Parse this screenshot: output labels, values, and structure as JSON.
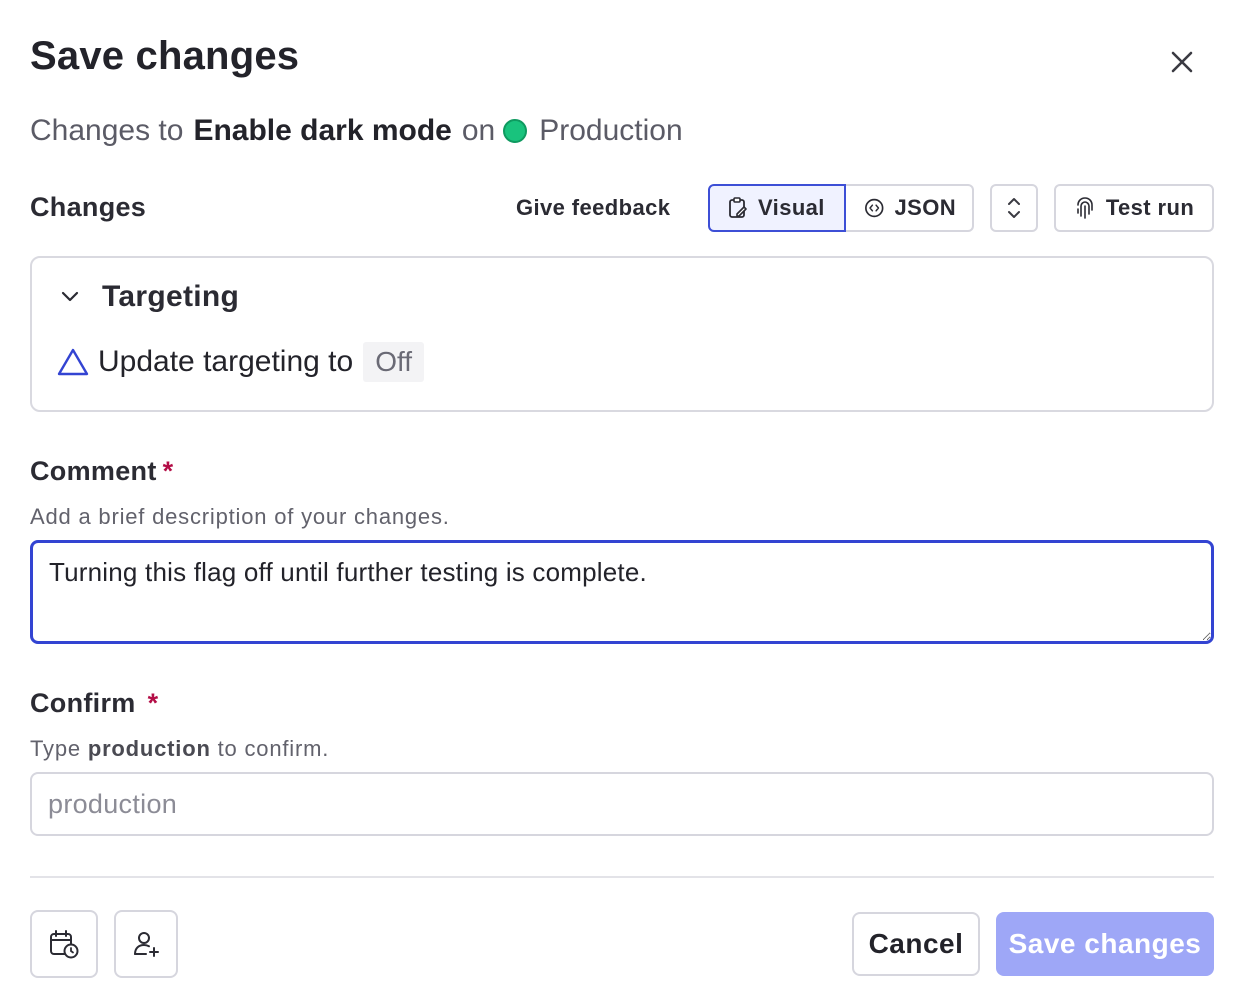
{
  "dialog": {
    "title": "Save changes",
    "close_icon": "close-icon"
  },
  "subtitle": {
    "prefix": "Changes to",
    "flag_name": "Enable dark mode",
    "connector": "on",
    "environment": "Production",
    "environment_color": "#19c37d"
  },
  "changes": {
    "label": "Changes",
    "feedback_label": "Give feedback",
    "view_tabs": [
      {
        "label": "Visual",
        "icon": "clipboard-edit-icon",
        "selected": true
      },
      {
        "label": "JSON",
        "icon": "code-circle-icon",
        "selected": false
      }
    ],
    "expand_icon": "chevron-up-down-icon",
    "test_run_label": "Test run",
    "test_run_icon": "fingerprint-icon"
  },
  "targeting": {
    "section_label": "Targeting",
    "toggle_icon": "chevron-down-icon",
    "update_text": "Update targeting to",
    "update_value": "Off",
    "warning_icon": "warning-triangle-icon"
  },
  "comment": {
    "label": "Comment",
    "required_mark": "*",
    "help": "Add a brief description of your changes.",
    "value": "Turning this flag off until further testing is complete."
  },
  "confirm": {
    "label": "Confirm",
    "required_mark": "*",
    "help_prefix": "Type",
    "help_keyword": "production",
    "help_suffix": "to confirm.",
    "placeholder": "production",
    "value": ""
  },
  "footer": {
    "schedule_icon": "calendar-clock-icon",
    "reviewer_icon": "user-plus-icon",
    "cancel_label": "Cancel",
    "save_label": "Save changes",
    "accent_color": "#3d4fd6",
    "save_disabled_color": "#9ea7f7"
  }
}
